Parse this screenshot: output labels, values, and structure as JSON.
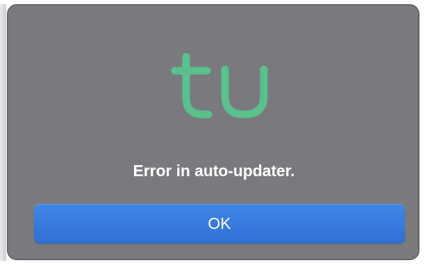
{
  "dialog": {
    "logo": {
      "icon": "tu-logo",
      "color": "#5ac08c"
    },
    "message": "Error in auto-updater.",
    "ok_label": "OK"
  },
  "colors": {
    "dialog_background": "#7a797e",
    "button_accent": "#3a7ce0"
  }
}
